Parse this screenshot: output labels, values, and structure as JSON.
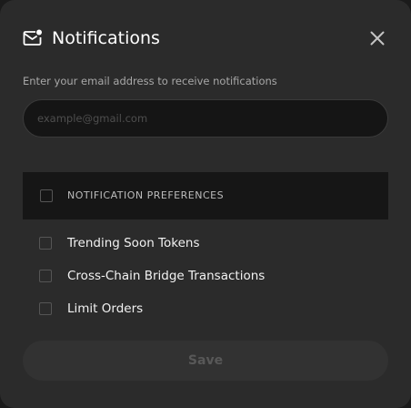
{
  "dialog": {
    "title": "Notifications",
    "subtitle": "Enter your email address to receive notifications",
    "header_icon": "mail-notification-icon",
    "close_icon": "close-icon"
  },
  "email": {
    "value": "",
    "placeholder": "example@gmail.com"
  },
  "preferences": {
    "header_label": "NOTIFICATION PREFERENCES",
    "header_checked": false,
    "items": [
      {
        "label": "Trending Soon Tokens",
        "checked": false
      },
      {
        "label": "Cross-Chain Bridge Transactions",
        "checked": false
      },
      {
        "label": "Limit Orders",
        "checked": false
      }
    ]
  },
  "actions": {
    "save_label": "Save",
    "save_enabled": false
  },
  "colors": {
    "modal_bg": "#2b2b2b",
    "input_bg": "#151515",
    "header_row_bg": "#161616",
    "text_primary": "#ffffff",
    "text_secondary": "#a8a8a8",
    "button_disabled_bg": "#323232",
    "button_disabled_text": "#585858"
  }
}
